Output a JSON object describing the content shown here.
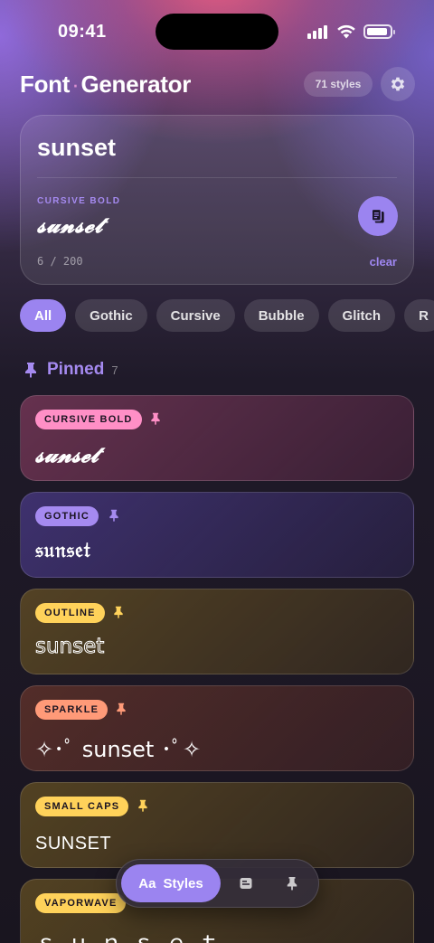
{
  "status_bar": {
    "time": "09:41"
  },
  "header": {
    "title_part1": "Font",
    "title_separator": "·",
    "title_part2": "Generator",
    "styles_count": "71 styles",
    "settings_icon": "gear-icon"
  },
  "input": {
    "value": "sunset",
    "preview_label": "CURSIVE BOLD",
    "preview_text": "𝓼𝓾𝓷𝓼𝓮𝓽",
    "copy_icon": "copy-icon",
    "char_count": "6 / 200",
    "clear_label": "clear"
  },
  "filters": {
    "chips": [
      {
        "label": "All",
        "active": true
      },
      {
        "label": "Gothic",
        "active": false
      },
      {
        "label": "Cursive",
        "active": false
      },
      {
        "label": "Bubble",
        "active": false
      },
      {
        "label": "Glitch",
        "active": false
      },
      {
        "label": "R",
        "active": false
      }
    ]
  },
  "pinned": {
    "title": "Pinned",
    "count": "7",
    "icon": "pin-icon"
  },
  "cards": [
    {
      "tag": "CURSIVE BOLD",
      "tag_color": "#ff8fc6",
      "pin_color": "#ff8fc6",
      "sample": "𝓼𝓾𝓷𝓼𝓮𝓽"
    },
    {
      "tag": "GOTHIC",
      "tag_color": "#a58af0",
      "pin_color": "#a58af0",
      "sample": "𝔰𝔲𝔫𝔰𝔢𝔱"
    },
    {
      "tag": "OUTLINE",
      "tag_color": "#ffd25a",
      "pin_color": "#ffd25a",
      "sample": "sunset"
    },
    {
      "tag": "SPARKLE",
      "tag_color": "#ff9a78",
      "pin_color": "#ff9a78",
      "sample": "✧･ﾟ sunset ･ﾟ✧"
    },
    {
      "tag": "SMALL CAPS",
      "tag_color": "#ffd25a",
      "pin_color": "#ffd25a",
      "sample": "SUNSET"
    },
    {
      "tag": "VAPORWAVE",
      "tag_color": "#ffd25a",
      "pin_color": "#ffd25a",
      "sample": "ｓｕｎｓｅｔ"
    }
  ],
  "bottom_nav": {
    "active_prefix": "Aa",
    "active_label": "Styles",
    "items": [
      "styles-icon",
      "history-icon",
      "pin-icon"
    ]
  }
}
